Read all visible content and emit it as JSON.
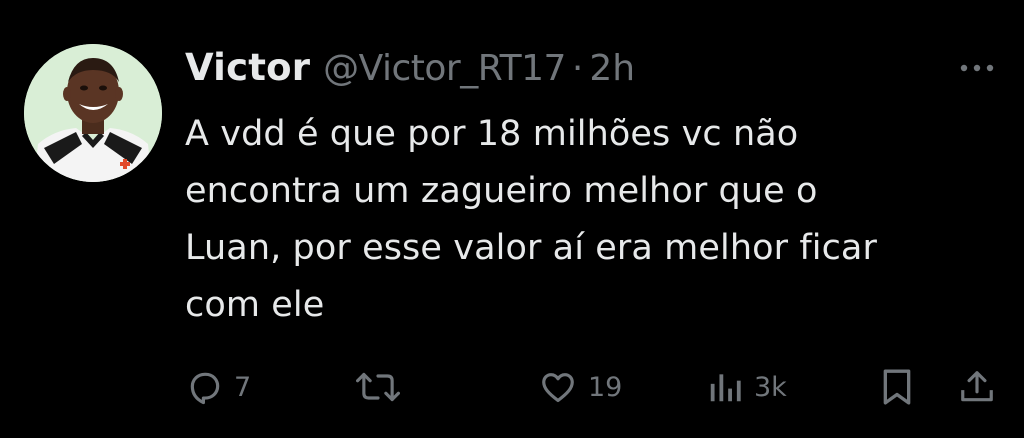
{
  "tweet": {
    "author": {
      "name": "Victor",
      "handle": "@Victor_RT17",
      "separator": "·",
      "time": "2h"
    },
    "text_lines": [
      "A vdd é que por 18 milhões vc não",
      "encontra um zagueiro melhor que o",
      "Luan, por esse valor aí era melhor ficar",
      "com ele"
    ],
    "actions": {
      "reply_count": "7",
      "repost_count": "",
      "like_count": "19",
      "views_count": "3k"
    },
    "icons": {
      "more": "more-horizontal-icon",
      "reply": "reply-icon",
      "repost": "repost-icon",
      "like": "heart-icon",
      "views": "analytics-icon",
      "bookmark": "bookmark-icon",
      "share": "share-icon"
    },
    "colors": {
      "background": "#000000",
      "primary_text": "#e7e9ea",
      "secondary_text": "#71767b"
    }
  }
}
